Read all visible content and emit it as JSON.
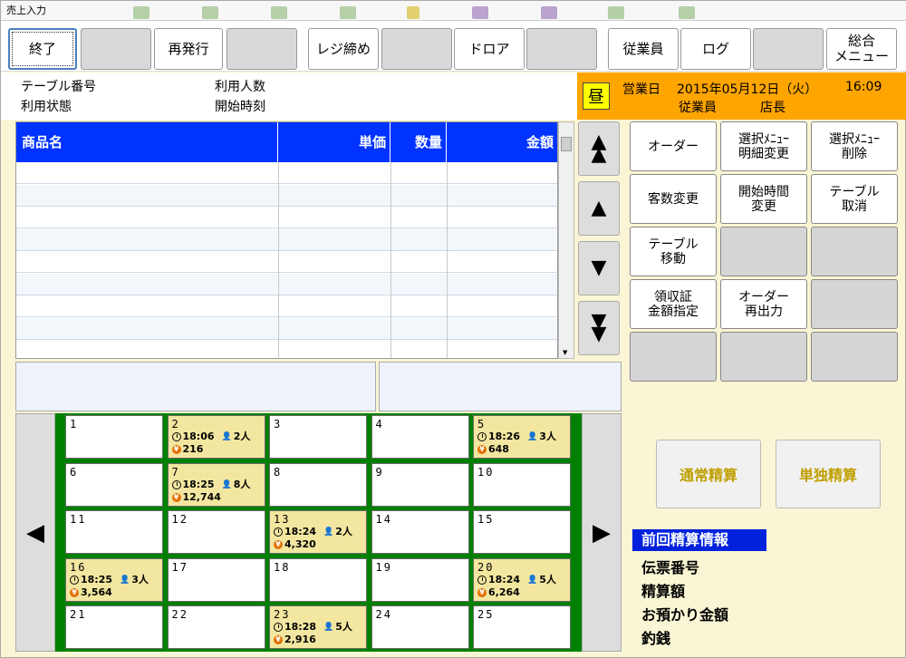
{
  "window": {
    "title": "売上入力"
  },
  "toolbar": {
    "exit": "終了",
    "reissue": "再発行",
    "register_close": "レジ締め",
    "drawer": "ドロア",
    "employee": "従業員",
    "log": "ログ",
    "general_menu": "総合\nメニュー"
  },
  "info": {
    "table_no_label": "テーブル番号",
    "usage_status_label": "利用状態",
    "people_label": "利用人数",
    "start_time_label": "開始時刻",
    "shift": "昼",
    "business_day_label": "営業日",
    "date": "2015年05月12日（火）",
    "time": "16:09",
    "employee_label": "従業員",
    "employee_name": "店長"
  },
  "grid": {
    "headers": [
      "商品名",
      "単価",
      "数量",
      "金額"
    ]
  },
  "tables": [
    {
      "no": "1"
    },
    {
      "no": "2",
      "time": "18:06",
      "people": "2人",
      "amount": "216"
    },
    {
      "no": "3"
    },
    {
      "no": "4"
    },
    {
      "no": "5",
      "time": "18:26",
      "people": "3人",
      "amount": "648"
    },
    {
      "no": "6"
    },
    {
      "no": "7",
      "time": "18:25",
      "people": "8人",
      "amount": "12,744"
    },
    {
      "no": "8"
    },
    {
      "no": "9"
    },
    {
      "no": "10"
    },
    {
      "no": "11"
    },
    {
      "no": "12"
    },
    {
      "no": "13",
      "time": "18:24",
      "people": "2人",
      "amount": "4,320"
    },
    {
      "no": "14"
    },
    {
      "no": "15"
    },
    {
      "no": "16",
      "time": "18:25",
      "people": "3人",
      "amount": "3,564"
    },
    {
      "no": "17"
    },
    {
      "no": "18"
    },
    {
      "no": "19"
    },
    {
      "no": "20",
      "time": "18:24",
      "people": "5人",
      "amount": "6,264"
    },
    {
      "no": "21"
    },
    {
      "no": "22"
    },
    {
      "no": "23",
      "time": "18:28",
      "people": "5人",
      "amount": "2,916"
    },
    {
      "no": "24"
    },
    {
      "no": "25"
    }
  ],
  "functions": {
    "order": "オーダー",
    "select_menu_edit": "選択ﾒﾆｭｰ\n明細変更",
    "select_menu_delete": "選択ﾒﾆｭｰ\n削除",
    "guest_count_change": "客数変更",
    "start_time_change": "開始時間\n変更",
    "table_cancel": "テーブル\n取消",
    "table_move": "テーブル\n移動",
    "receipt_amount": "領収証\n金額指定",
    "order_reprint": "オーダー\n再出力"
  },
  "settle": {
    "normal": "通常精算",
    "single": "単独精算"
  },
  "prev_settlement": {
    "title": "前回精算情報",
    "slip_no": "伝票番号",
    "amount": "精算額",
    "deposit": "お預かり金額",
    "change": "釣銭"
  },
  "colors": {
    "header_blue": "#0033ff",
    "orange": "#ffa500",
    "green": "#008000",
    "occupied": "#f3e6a0"
  }
}
